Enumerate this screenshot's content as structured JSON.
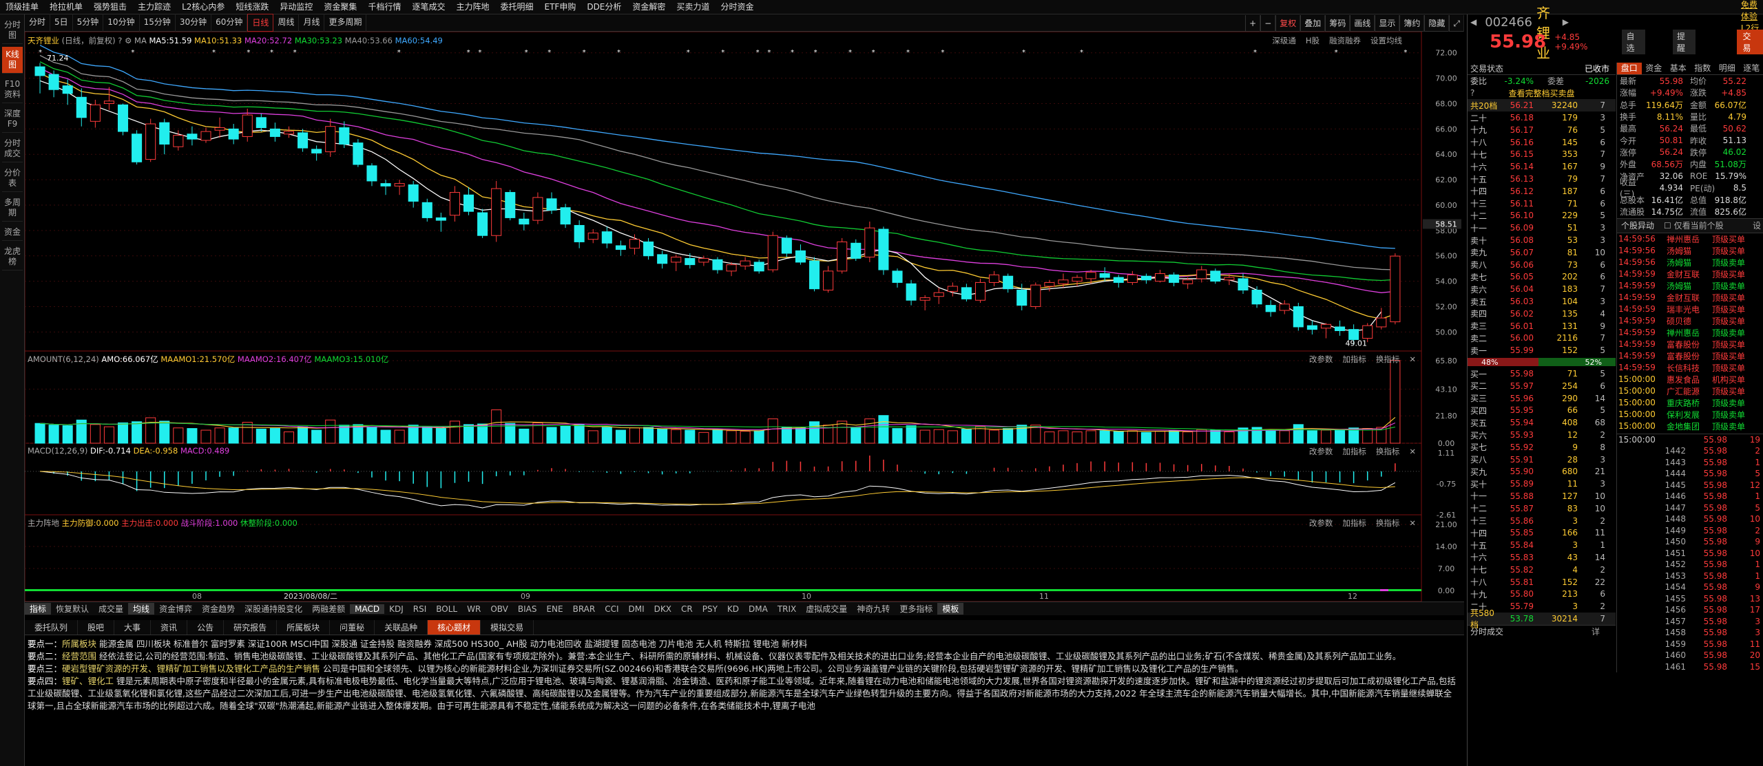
{
  "topbar": [
    "顶级挂单",
    "抢拉机单",
    "强势狙击",
    "主力踪迹",
    "L2核心内参",
    "短线涨跌",
    "异动监控",
    "资金聚集",
    "千档行情",
    "逐笔成交",
    "主力阵地",
    "委托明细",
    "ETF申购",
    "DDE分析",
    "资金解密",
    "买卖力道",
    "分时资金"
  ],
  "leftnav": [
    "分时图",
    "K线图",
    "F10资料",
    "深度F9",
    "分时成交",
    "分价表",
    "多周期",
    "资金",
    "龙虎榜"
  ],
  "periods": [
    "分时",
    "5日",
    "5分钟",
    "10分钟",
    "15分钟",
    "30分钟",
    "60分钟",
    "日线",
    "周线",
    "月线",
    "更多周期"
  ],
  "ptools": [
    "复权",
    "叠加",
    "筹码",
    "画线",
    "显示",
    "簿约",
    "隐藏"
  ],
  "main_legend": {
    "name": "天齐锂业",
    "mode": "(日线，前复权)",
    "ma5": "MA5:51.59",
    "ma10": "MA10:51.33",
    "ma20": "MA20:52.72",
    "ma30": "MA30:53.23",
    "ma40": "MA40:53.66",
    "ma60": "MA60:54.49"
  },
  "main_right": [
    "深级通",
    "H股",
    "融资融券",
    "设置均线"
  ],
  "amount_legend": {
    "label": "AMOUNT(6,12,24)",
    "amo": "AMO:66.067亿",
    "m1": "MAAMO1:21.570亿",
    "m2": "MAAMO2:16.407亿",
    "m3": "MAAMO3:15.010亿"
  },
  "macd_legend": {
    "label": "MACD(12,26,9)",
    "dif": "DIF:-0.714",
    "dea": "DEA:-0.958",
    "macd": "MACD:0.489"
  },
  "zl_legend": {
    "label": "主力阵地",
    "a": "主力防御:0.000",
    "b": "主力出击:0.000",
    "c": "战斗阶段:1.000",
    "d": "休整阶段:0.000"
  },
  "panel_right": [
    "改参数",
    "加指标",
    "换指标"
  ],
  "yaxis_main": [
    "72.00",
    "70.00",
    "68.00",
    "66.00",
    "64.00",
    "62.00",
    "60.00",
    "58.51",
    "58.00",
    "56.00",
    "54.00",
    "52.00",
    "50.00"
  ],
  "yaxis_amt": [
    "65.80",
    "43.10",
    "21.80",
    "0.00"
  ],
  "yaxis_macd": [
    "1.11",
    "-0.75",
    "-2.61"
  ],
  "yaxis_zl": [
    "21.00",
    "14.00",
    "7.00",
    "0.00"
  ],
  "xaxis": [
    "08",
    "2023/08/08/二",
    "09",
    "10",
    "11",
    "12"
  ],
  "hi_label": "71.24",
  "lo_label": "49.01",
  "indicators": [
    "指标",
    "恢复默认",
    "成交量",
    "均线",
    "资金博弈",
    "资金趋势",
    "深股通持股变化",
    "两融差额",
    "MACD",
    "KDJ",
    "RSI",
    "BOLL",
    "WR",
    "OBV",
    "BIAS",
    "ENE",
    "BRAR",
    "CCI",
    "DMI",
    "DKX",
    "CR",
    "PSY",
    "KD",
    "DMA",
    "TRIX",
    "虚拟成交量",
    "神奇九转",
    "更多指标",
    "模板"
  ],
  "f10tabs": [
    "委托队列",
    "股吧",
    "大事",
    "资讯",
    "公告",
    "研究报告",
    "所属板块",
    "问董秘",
    "关联品种",
    "核心题材",
    "模拟交易"
  ],
  "f10": [
    {
      "tag": "要点一：",
      "title": "所属板块",
      "body": "  能源金属 四川板块 标准普尔 富时罗素 深证100R MSCI中国 深股通 证金持股 融资融券 深成500 HS300_ AH股 动力电池回收 盐湖提锂 固态电池 刀片电池 无人机 特斯拉 锂电池 新材料"
    },
    {
      "tag": "要点二：",
      "title": "经营范围",
      "body": "  经依法登记,公司的经营范围:制造、销售电池级碳酸锂、工业级碳酸锂及其系列产品、其他化工产品(国家有专项规定除外)。兼营:本企业生产、科研所需的原辅材料、机械设备、仪器仪表零配件及相关技术的进出口业务;经营本企业自产的电池级碳酸锂、工业级碳酸锂及其系列产品的出口业务;矿石(不含煤炭、稀贵金属)及其系列产品加工业务。"
    },
    {
      "tag": "要点三：",
      "title": "硬岩型锂矿资源的开发、锂精矿加工销售以及锂化工产品的生产销售",
      "body": "  公司是中国和全球领先、以锂为核心的新能源材料企业,为深圳证券交易所(SZ.002466)和香港联合交易所(9696.HK)两地上市公司。公司业务涵盖锂产业链的关键阶段,包括硬岩型锂矿资源的开发、锂精矿加工销售以及锂化工产品的生产销售。"
    },
    {
      "tag": "要点四：",
      "title": "锂矿、锂化工",
      "body": "  锂是元素周期表中原子密度和半径最小的金属元素,具有标准电极电势最低、电化学当量最大等特点,广泛应用于锂电池、玻璃与陶瓷、锂基润滑脂、冶金铸造、医药和原子能工业等领域。近年来,随着锂在动力电池和储能电池领域的大力发展,世界各国对锂资源勘探开发的速度逐步加快。锂矿和盐湖中的锂资源经过初步提取后可加工成初级锂化工产品,包括工业级碳酸锂、工业级氢氧化锂和氯化锂,这些产品经过二次深加工后,可进一步生产出电池级碳酸锂、电池级氢氧化锂、六氟磷酸锂、高纯碳酸锂以及金属锂等。作为汽车产业的重要组成部分,新能源汽车是全球汽车产业绿色转型升级的主要方向。得益于各国政府对新能源市场的大力支持,2022 年全球主流车企的新能源汽车销量大幅增长。其中,中国新能源汽车销量继续蝉联全球第一,且占全球新能源汽车市场的比例超过六成。随着全球\"双碳\"热潮涌起,新能源产业链进入整体爆发期。由于可再生能源具有不稳定性,储能系统成为解决这一问题的必备条件,在各类储能技术中,锂离子电池"
    }
  ],
  "quote": {
    "code": "002466",
    "name": "天齐锂业",
    "price": "55.98",
    "chg": "+4.85",
    "pct": "+9.49%",
    "free": "免费体验L2行情",
    "zixuan": "自选",
    "tixing": "提醒",
    "jiaoyi": "交易"
  },
  "status": {
    "label": "交易状态",
    "value": "已收市"
  },
  "weibi": {
    "k1": "委比",
    "v1": "-3.24%",
    "k2": "委差",
    "v2": "-2026"
  },
  "orderbook_link": "查看完整档买卖盘",
  "sell_head": {
    "label": "共20档",
    "price": "56.21",
    "vol": "32240",
    "cnt": "7"
  },
  "sells": [
    [
      "二十",
      "56.18",
      "179",
      "3"
    ],
    [
      "十九",
      "56.17",
      "76",
      "5"
    ],
    [
      "十八",
      "56.16",
      "145",
      "6"
    ],
    [
      "十七",
      "56.15",
      "353",
      "7"
    ],
    [
      "十六",
      "56.14",
      "167",
      "9"
    ],
    [
      "十五",
      "56.13",
      "79",
      "7"
    ],
    [
      "十四",
      "56.12",
      "187",
      "6"
    ],
    [
      "十三",
      "56.11",
      "71",
      "6"
    ],
    [
      "十二",
      "56.10",
      "229",
      "5"
    ],
    [
      "十一",
      "56.09",
      "51",
      "3"
    ],
    [
      "卖十",
      "56.08",
      "53",
      "3"
    ],
    [
      "卖九",
      "56.07",
      "81",
      "10"
    ],
    [
      "卖八",
      "56.06",
      "73",
      "6"
    ],
    [
      "卖七",
      "56.05",
      "202",
      "6"
    ],
    [
      "卖六",
      "56.04",
      "183",
      "7"
    ],
    [
      "卖五",
      "56.03",
      "104",
      "3"
    ],
    [
      "卖四",
      "56.02",
      "135",
      "4"
    ],
    [
      "卖三",
      "56.01",
      "131",
      "9"
    ],
    [
      "卖二",
      "56.00",
      "2116",
      "7"
    ],
    [
      "卖一",
      "55.99",
      "152",
      "5"
    ]
  ],
  "ratio": {
    "buy": "48%",
    "sell": "52%"
  },
  "buys": [
    [
      "买一",
      "55.98",
      "71",
      "5"
    ],
    [
      "买二",
      "55.97",
      "254",
      "6"
    ],
    [
      "买三",
      "55.96",
      "290",
      "14"
    ],
    [
      "买四",
      "55.95",
      "66",
      "5"
    ],
    [
      "买五",
      "55.94",
      "408",
      "68"
    ],
    [
      "买六",
      "55.93",
      "12",
      "2"
    ],
    [
      "买七",
      "55.92",
      "9",
      "8"
    ],
    [
      "买八",
      "55.91",
      "28",
      "3"
    ],
    [
      "买九",
      "55.90",
      "680",
      "21"
    ],
    [
      "买十",
      "55.89",
      "11",
      "3"
    ],
    [
      "十一",
      "55.88",
      "127",
      "10"
    ],
    [
      "十二",
      "55.87",
      "83",
      "10"
    ],
    [
      "十三",
      "55.86",
      "3",
      "2"
    ],
    [
      "十四",
      "55.85",
      "166",
      "11"
    ],
    [
      "十五",
      "55.84",
      "3",
      "1"
    ],
    [
      "十六",
      "55.83",
      "43",
      "14"
    ],
    [
      "十七",
      "55.82",
      "4",
      "2"
    ],
    [
      "十八",
      "55.81",
      "152",
      "22"
    ],
    [
      "十九",
      "55.80",
      "213",
      "6"
    ],
    [
      "二十",
      "55.79",
      "3",
      "2"
    ]
  ],
  "buy_foot": {
    "label": "共580档",
    "price": "53.78",
    "vol": "30214",
    "cnt": "7"
  },
  "fenshi_label": "分时成交",
  "rtabs": [
    "盘口",
    "资金",
    "基本",
    "指数",
    "明细",
    "逐笔"
  ],
  "stats": [
    [
      "最新",
      "55.98",
      "均价",
      "55.22"
    ],
    [
      "涨幅",
      "+9.49%",
      "涨跌",
      "+4.85"
    ],
    [
      "总手",
      "119.64万",
      "金额",
      "66.07亿"
    ],
    [
      "换手",
      "8.11%",
      "量比",
      "4.79"
    ],
    [
      "最高",
      "56.24",
      "最低",
      "50.62"
    ],
    [
      "今开",
      "50.81",
      "昨收",
      "51.13"
    ],
    [
      "涨停",
      "56.24",
      "跌停",
      "46.02"
    ],
    [
      "外盘",
      "68.56万",
      "内盘",
      "51.08万"
    ],
    [
      "净资产",
      "32.06",
      "ROE",
      "15.79%"
    ],
    [
      "收益(三)",
      "4.934",
      "PE(动)",
      "8.5"
    ],
    [
      "总股本",
      "16.41亿",
      "总值",
      "918.8亿"
    ],
    [
      "流通股",
      "14.75亿",
      "流值",
      "825.6亿"
    ]
  ],
  "yidong": {
    "title": "个股异动",
    "opt": "仅看当前个股"
  },
  "yidong_rows": [
    [
      "14:59:56",
      "禅州惠岳",
      "顶级买单"
    ],
    [
      "14:59:56",
      "汤姆猫",
      "顶级买单"
    ],
    [
      "14:59:56",
      "汤姆猫",
      "顶级卖单"
    ],
    [
      "14:59:59",
      "金财互联",
      "顶级买单"
    ],
    [
      "14:59:59",
      "汤姆猫",
      "顶级卖单"
    ],
    [
      "14:59:59",
      "金财互联",
      "顶级买单"
    ],
    [
      "14:59:59",
      "瑞丰光电",
      "顶级买单"
    ],
    [
      "14:59:59",
      "硕贝德",
      "顶级买单"
    ],
    [
      "14:59:59",
      "禅州惠岳",
      "顶级卖单"
    ],
    [
      "14:59:59",
      "富春股份",
      "顶级买单"
    ],
    [
      "14:59:59",
      "富春股份",
      "顶级买单"
    ],
    [
      "14:59:59",
      "长信科技",
      "顶级买单"
    ],
    [
      "15:00:00",
      "惠发食品",
      "机构买单"
    ],
    [
      "15:00:00",
      "广汇能源",
      "顶级买单"
    ],
    [
      "15:00:00",
      "重庆路桥",
      "顶级卖单"
    ],
    [
      "15:00:00",
      "保利发展",
      "顶级卖单"
    ],
    [
      "15:00:00",
      "金地集团",
      "顶级卖单"
    ]
  ],
  "ticks": [
    [
      "15:00:00",
      "",
      "55.98",
      "19"
    ],
    [
      "",
      "1442",
      "55.98",
      "2"
    ],
    [
      "",
      "1443",
      "55.98",
      "1"
    ],
    [
      "",
      "1444",
      "55.98",
      "5"
    ],
    [
      "",
      "1445",
      "55.98",
      "12"
    ],
    [
      "",
      "1446",
      "55.98",
      "1"
    ],
    [
      "",
      "1447",
      "55.98",
      "5"
    ],
    [
      "",
      "1448",
      "55.98",
      "10"
    ],
    [
      "",
      "1449",
      "55.98",
      "2"
    ],
    [
      "",
      "1450",
      "55.98",
      "9"
    ],
    [
      "",
      "1451",
      "55.98",
      "10"
    ],
    [
      "",
      "1452",
      "55.98",
      "1"
    ],
    [
      "",
      "1453",
      "55.98",
      "1"
    ],
    [
      "",
      "1454",
      "55.98",
      "9"
    ],
    [
      "",
      "1455",
      "55.98",
      "13"
    ],
    [
      "",
      "1456",
      "55.98",
      "17"
    ],
    [
      "",
      "1457",
      "55.98",
      "3"
    ],
    [
      "",
      "1458",
      "55.98",
      "3"
    ],
    [
      "",
      "1459",
      "55.98",
      "11"
    ],
    [
      "",
      "1460",
      "55.98",
      "20"
    ],
    [
      "",
      "1461",
      "55.98",
      "15"
    ]
  ],
  "candles": [
    [
      70.9,
      71.2,
      68.8,
      70.2
    ],
    [
      70.3,
      70.6,
      68.5,
      69.1
    ],
    [
      69.4,
      69.9,
      67.9,
      68.8
    ],
    [
      68.5,
      69.2,
      66.2,
      66.9
    ],
    [
      66.6,
      68.3,
      66.1,
      67.9
    ],
    [
      68.0,
      69.3,
      67.5,
      68.2
    ],
    [
      67.9,
      68.0,
      65.5,
      65.8
    ],
    [
      65.6,
      65.9,
      63.2,
      63.4
    ],
    [
      63.6,
      66.8,
      63.4,
      66.4
    ],
    [
      66.5,
      66.8,
      64.0,
      64.8
    ],
    [
      64.6,
      65.9,
      64.3,
      65.5
    ],
    [
      65.6,
      66.2,
      64.7,
      65.2
    ],
    [
      65.1,
      66.1,
      64.9,
      65.8
    ],
    [
      65.9,
      66.9,
      65.3,
      66.1
    ],
    [
      66.0,
      66.4,
      64.8,
      65.2
    ],
    [
      65.4,
      67.6,
      65.0,
      67.1
    ],
    [
      66.9,
      67.2,
      65.8,
      66.1
    ],
    [
      66.0,
      66.5,
      65.0,
      65.4
    ],
    [
      65.6,
      66.2,
      65.3,
      65.8
    ],
    [
      65.7,
      66.0,
      64.2,
      64.5
    ],
    [
      64.4,
      64.7,
      63.5,
      64.1
    ],
    [
      64.2,
      66.8,
      63.8,
      66.2
    ],
    [
      66.1,
      66.6,
      64.5,
      64.8
    ],
    [
      64.9,
      65.2,
      63.0,
      63.2
    ],
    [
      63.1,
      63.3,
      61.5,
      61.9
    ],
    [
      61.7,
      62.0,
      60.8,
      61.5
    ],
    [
      61.5,
      62.0,
      60.8,
      61.7
    ],
    [
      61.6,
      61.9,
      59.8,
      60.3
    ],
    [
      60.2,
      60.5,
      58.7,
      59.0
    ],
    [
      59.0,
      59.4,
      57.9,
      58.8
    ],
    [
      59.2,
      61.5,
      58.7,
      61.0
    ],
    [
      60.8,
      61.4,
      59.2,
      59.5
    ],
    [
      59.4,
      59.7,
      57.4,
      57.6
    ],
    [
      57.6,
      61.9,
      57.1,
      61.3
    ],
    [
      61.0,
      61.2,
      58.8,
      59.0
    ],
    [
      58.9,
      59.4,
      58.0,
      58.5
    ],
    [
      58.8,
      61.0,
      58.5,
      60.6
    ],
    [
      60.5,
      61.0,
      59.3,
      59.6
    ],
    [
      59.8,
      60.1,
      58.2,
      58.5
    ],
    [
      58.4,
      58.8,
      56.6,
      57.1
    ],
    [
      57.3,
      58.1,
      57.0,
      57.8
    ],
    [
      57.9,
      58.3,
      56.6,
      57.0
    ],
    [
      56.8,
      57.2,
      56.0,
      56.5
    ],
    [
      56.6,
      57.7,
      56.1,
      57.3
    ],
    [
      57.1,
      57.4,
      55.7,
      56.0
    ],
    [
      56.1,
      56.4,
      55.0,
      55.4
    ],
    [
      55.5,
      56.1,
      54.8,
      55.9
    ],
    [
      55.8,
      56.2,
      55.0,
      55.3
    ],
    [
      55.5,
      56.0,
      55.2,
      55.8
    ],
    [
      55.7,
      55.9,
      54.6,
      54.9
    ],
    [
      54.8,
      55.5,
      54.4,
      55.3
    ],
    [
      55.2,
      55.9,
      54.9,
      55.6
    ],
    [
      55.5,
      55.7,
      54.6,
      54.8
    ],
    [
      54.9,
      57.9,
      54.7,
      57.6
    ],
    [
      57.4,
      57.6,
      55.9,
      56.2
    ],
    [
      56.4,
      56.9,
      55.3,
      55.5
    ],
    [
      55.6,
      55.9,
      53.2,
      53.4
    ],
    [
      53.3,
      55.2,
      53.1,
      54.8
    ],
    [
      54.8,
      57.4,
      54.6,
      57.1
    ],
    [
      57.0,
      57.3,
      55.6,
      55.8
    ],
    [
      55.9,
      58.7,
      55.5,
      58.2
    ],
    [
      58.1,
      58.3,
      54.5,
      54.9
    ],
    [
      54.8,
      55.0,
      53.5,
      53.9
    ],
    [
      53.8,
      54.1,
      52.1,
      52.5
    ],
    [
      52.5,
      52.9,
      51.7,
      52.7
    ],
    [
      52.8,
      53.5,
      52.2,
      53.1
    ],
    [
      53.2,
      53.9,
      52.8,
      53.6
    ],
    [
      53.5,
      53.8,
      52.4,
      52.6
    ],
    [
      52.5,
      54.2,
      52.3,
      53.9
    ],
    [
      53.9,
      54.8,
      53.6,
      54.5
    ],
    [
      54.4,
      54.6,
      53.1,
      53.4
    ],
    [
      53.3,
      53.8,
      51.7,
      52.1
    ],
    [
      52.0,
      53.9,
      51.8,
      53.7
    ],
    [
      53.6,
      54.1,
      53.2,
      53.9
    ],
    [
      53.8,
      54.6,
      53.5,
      54.1
    ],
    [
      54.0,
      54.5,
      53.6,
      54.3
    ],
    [
      54.2,
      54.9,
      53.8,
      54.7
    ],
    [
      54.6,
      55.1,
      54.0,
      54.3
    ],
    [
      54.3,
      54.5,
      53.5,
      53.9
    ],
    [
      53.9,
      54.8,
      53.7,
      54.5
    ],
    [
      54.4,
      54.6,
      53.8,
      54.1
    ],
    [
      54.0,
      54.9,
      53.9,
      54.6
    ],
    [
      54.5,
      54.7,
      53.6,
      53.9
    ],
    [
      53.8,
      54.3,
      53.4,
      54.1
    ],
    [
      54.2,
      55.2,
      53.9,
      54.9
    ],
    [
      54.8,
      55.0,
      53.8,
      54.0
    ],
    [
      54.1,
      54.6,
      53.7,
      54.3
    ],
    [
      54.2,
      54.6,
      53.0,
      53.3
    ],
    [
      53.3,
      53.6,
      51.9,
      52.2
    ],
    [
      52.1,
      52.5,
      51.2,
      51.6
    ],
    [
      51.7,
      52.5,
      51.4,
      52.2
    ],
    [
      52.0,
      52.3,
      50.1,
      50.4
    ],
    [
      50.5,
      50.9,
      49.8,
      50.2
    ],
    [
      50.3,
      50.7,
      49.5,
      50.6
    ],
    [
      50.4,
      50.9,
      49.7,
      50.1
    ],
    [
      50.2,
      50.6,
      49.0,
      49.4
    ],
    [
      49.5,
      50.7,
      49.2,
      50.5
    ],
    [
      50.4,
      51.9,
      50.2,
      51.1
    ],
    [
      50.8,
      56.2,
      50.6,
      55.98
    ]
  ],
  "ma5": [
    69.8,
    69.4,
    68.9,
    68.2,
    67.8,
    67.4,
    67.0,
    66.6,
    66.2,
    65.9,
    65.6,
    65.3,
    65.1,
    65.4,
    65.6,
    65.8,
    65.9,
    65.8,
    65.6,
    65.3,
    65.0,
    64.9,
    64.8,
    64.6,
    64.2,
    63.6,
    62.8,
    62.1,
    61.3,
    60.6,
    60.2,
    59.9,
    59.6,
    59.7,
    59.7,
    59.6,
    59.5,
    59.6,
    59.7,
    59.2,
    58.8,
    58.3,
    57.8,
    57.4,
    56.9,
    56.5,
    56.2,
    56.0,
    55.8,
    55.6,
    55.4,
    55.3,
    55.2,
    55.5,
    55.8,
    56.0,
    55.8,
    55.6,
    55.8,
    55.9,
    56.3,
    56.5,
    56.2,
    55.4,
    54.3,
    53.5,
    53.1,
    52.9,
    53.1,
    53.4,
    53.5,
    53.4,
    53.3,
    53.4,
    53.5,
    53.6,
    53.8,
    54.0,
    54.1,
    54.2,
    54.2,
    54.3,
    54.2,
    54.2,
    54.2,
    54.2,
    54.1,
    53.8,
    53.3,
    52.7,
    52.1,
    51.4,
    50.9,
    50.6,
    50.2,
    50.1,
    50.2,
    51.6
  ]
}
